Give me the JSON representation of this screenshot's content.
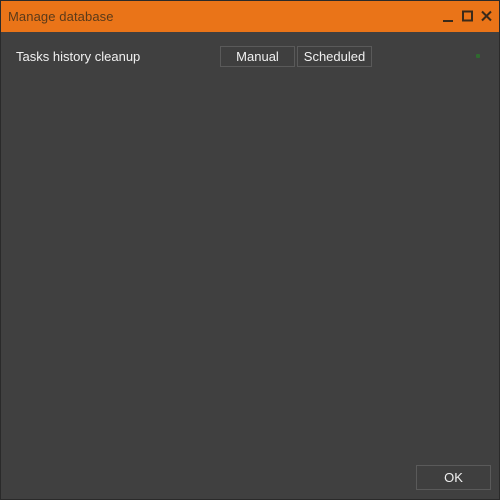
{
  "window": {
    "title": "Manage database",
    "accent_color": "#ea7418",
    "controls": {
      "minimize_icon": "minimize-icon",
      "maximize_icon": "maximize-icon",
      "close_icon": "close-icon"
    }
  },
  "main": {
    "row_label": "Tasks history cleanup",
    "buttons": {
      "manual_label": "Manual",
      "scheduled_label": "Scheduled"
    },
    "status_color": "#2f6a2f"
  },
  "footer": {
    "ok_label": "OK"
  }
}
